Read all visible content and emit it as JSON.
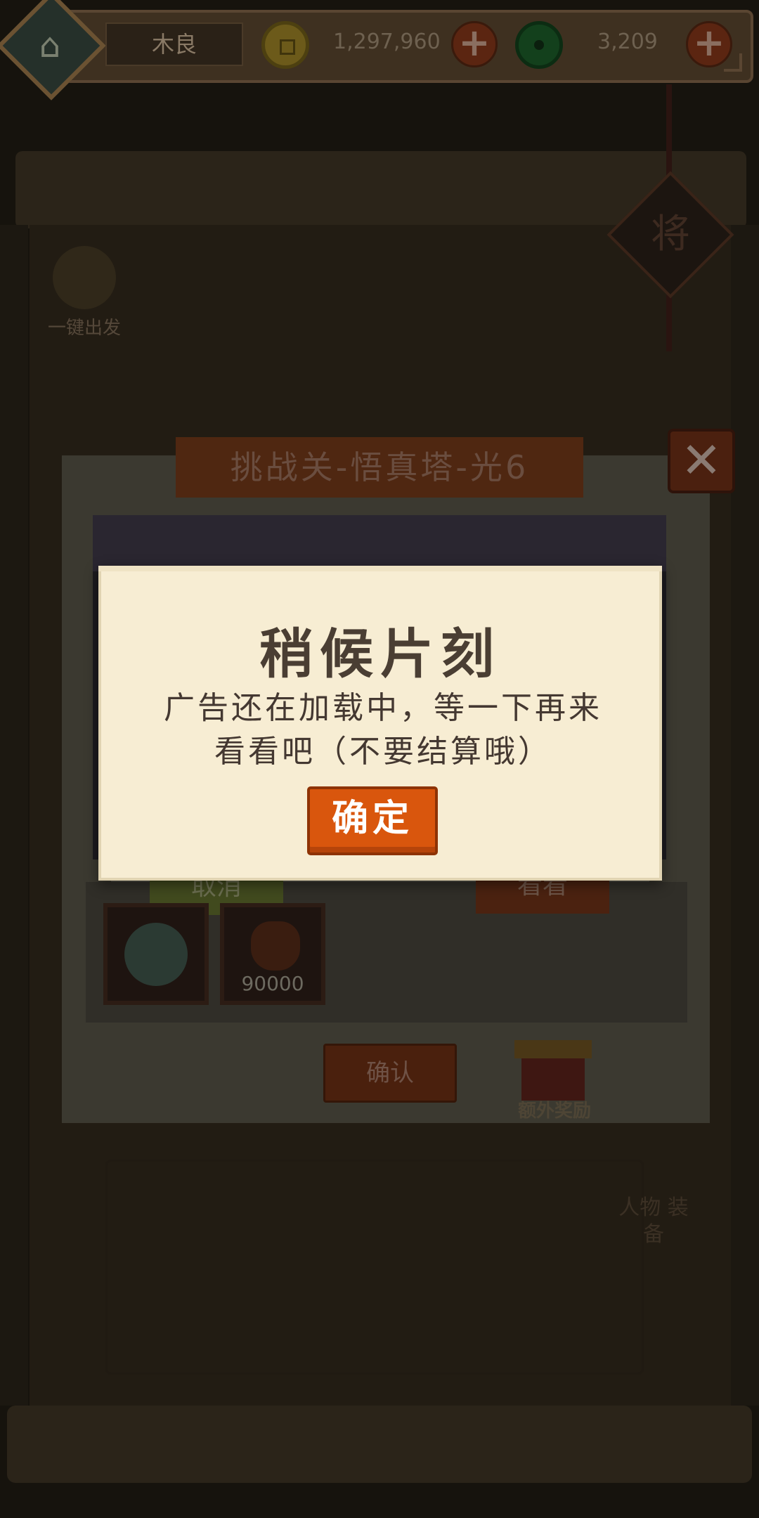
{
  "topbar": {
    "player_name": "木良",
    "gold_amount": "1,297,960",
    "jade_amount": "3,209",
    "plus_symbol": "+"
  },
  "background": {
    "depart_label": "一键出发",
    "rank_seal": "将",
    "side_tag": "人物 装备"
  },
  "challenge": {
    "title": "挑战关-悟真塔-光6",
    "close_symbol": "✕",
    "cancel_label": "取消",
    "watch_label": "看看",
    "reward_coin_qty": "90000",
    "confirm_label": "确认",
    "bonus_label": "额外奖励"
  },
  "popup": {
    "title": "稍候片刻",
    "message_line1": "广告还在加载中，等一下再来",
    "message_line2": "看看吧（不要结算哦）",
    "ok_label": "确定"
  },
  "icons": {
    "avatar": "pagoda-icon",
    "gold": "gold-coin-icon",
    "jade": "jade-coin-icon"
  },
  "colors": {
    "ok_button": "#d9560d",
    "popup_bg": "#f7edd3"
  }
}
